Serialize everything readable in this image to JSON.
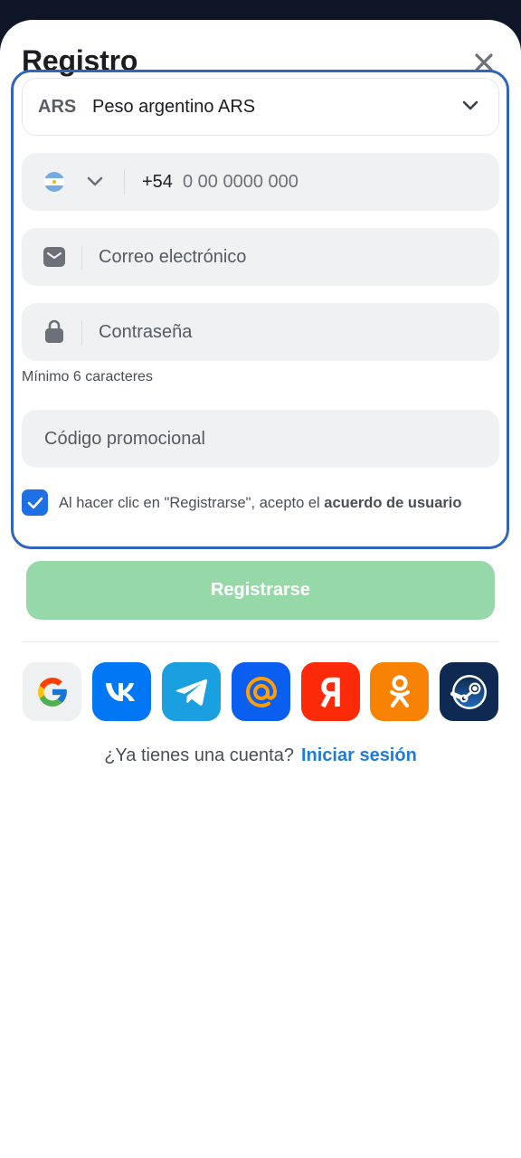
{
  "header": {
    "title": "Registro"
  },
  "currency": {
    "code": "ARS",
    "name": "Peso argentino ARS"
  },
  "phone": {
    "country_code": "+54",
    "placeholder": "0 00 0000 000"
  },
  "email": {
    "placeholder": "Correo electrónico"
  },
  "password": {
    "placeholder": "Contraseña",
    "hint": "Mínimo 6 caracteres"
  },
  "promo": {
    "placeholder": "Código promocional"
  },
  "terms": {
    "checked": true,
    "text": "Al hacer clic en \"Registrarse\", acepto el ",
    "link": "acuerdo de usuario"
  },
  "register_button": {
    "label": "Registrarse"
  },
  "social": [
    {
      "name": "google-icon",
      "color": "#eef0f2"
    },
    {
      "name": "vk-icon",
      "color": "#0277f5"
    },
    {
      "name": "telegram-icon",
      "color": "#1a9fe0"
    },
    {
      "name": "mailru-icon",
      "color": "#0a5ff0"
    },
    {
      "name": "yandex-icon",
      "color": "#fc2a08"
    },
    {
      "name": "odnoklassniki-icon",
      "color": "#f78204"
    },
    {
      "name": "steam-icon",
      "color": "#0f2a52"
    }
  ],
  "login": {
    "question": "¿Ya tienes una cuenta?",
    "link": "Iniciar sesión"
  },
  "colors": {
    "accent": "#1f6fe5",
    "focus_border": "#2f65bd",
    "button_disabled": "#97d8a9",
    "link": "#1f7bd8"
  }
}
